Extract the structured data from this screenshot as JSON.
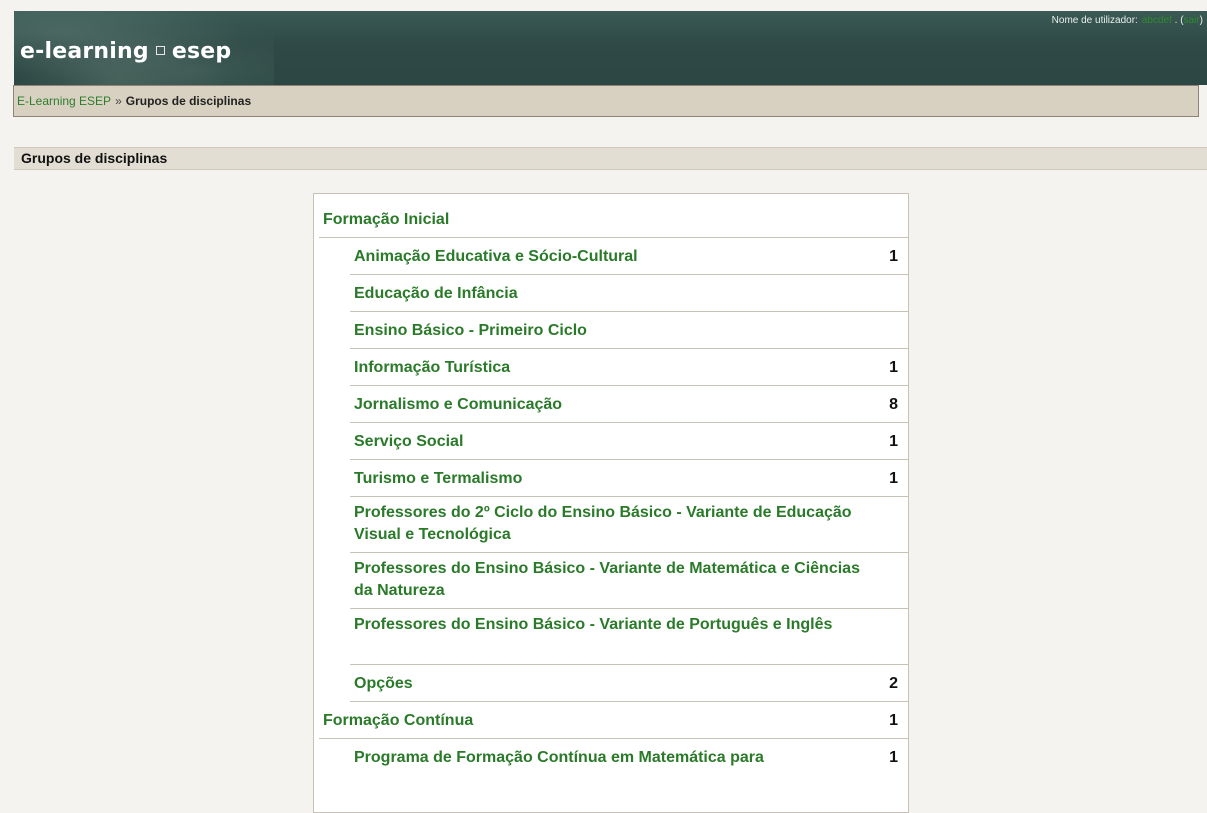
{
  "header": {
    "logo_left": "e-learning",
    "logo_right": "esep",
    "user_label": "Nome de utilizador:",
    "user_name": "abcdef",
    "logout_prefix": ". (",
    "logout_label": "sair",
    "logout_suffix": ")"
  },
  "breadcrumb": {
    "home": "E-Learning ESEP",
    "separator": "»",
    "current": "Grupos de disciplinas"
  },
  "page": {
    "title": "Grupos de disciplinas"
  },
  "categories": [
    {
      "label": "Formação Inicial",
      "count": ""
    },
    {
      "label": "Animação Educativa e Sócio-Cultural",
      "count": "1"
    },
    {
      "label": "Educação de Infância",
      "count": ""
    },
    {
      "label": "Ensino Básico - Primeiro Ciclo",
      "count": ""
    },
    {
      "label": "Informação Turística",
      "count": "1"
    },
    {
      "label": "Jornalismo e Comunicação",
      "count": "8"
    },
    {
      "label": "Serviço Social",
      "count": "1"
    },
    {
      "label": "Turismo e Termalismo",
      "count": "1"
    },
    {
      "label": "Professores do 2º Ciclo do Ensino Básico - Variante de Educação Visual e Tecnológica",
      "count": ""
    },
    {
      "label": "Professores do Ensino Básico - Variante de Matemática e Ciências da Natureza",
      "count": ""
    },
    {
      "label": "Professores do Ensino Básico - Variante de Português e Inglês",
      "count": ""
    },
    {
      "label": "Opções",
      "count": "2"
    },
    {
      "label": "Formação Contínua",
      "count": "1"
    },
    {
      "label": "Programa de Formação Contínua em Matemática para",
      "count": "1"
    }
  ],
  "colors": {
    "header_bg": "#2f4a46",
    "link": "#2a7a2a",
    "nav_bg": "#d8d1c2",
    "page_bg": "#f5f3ef"
  }
}
